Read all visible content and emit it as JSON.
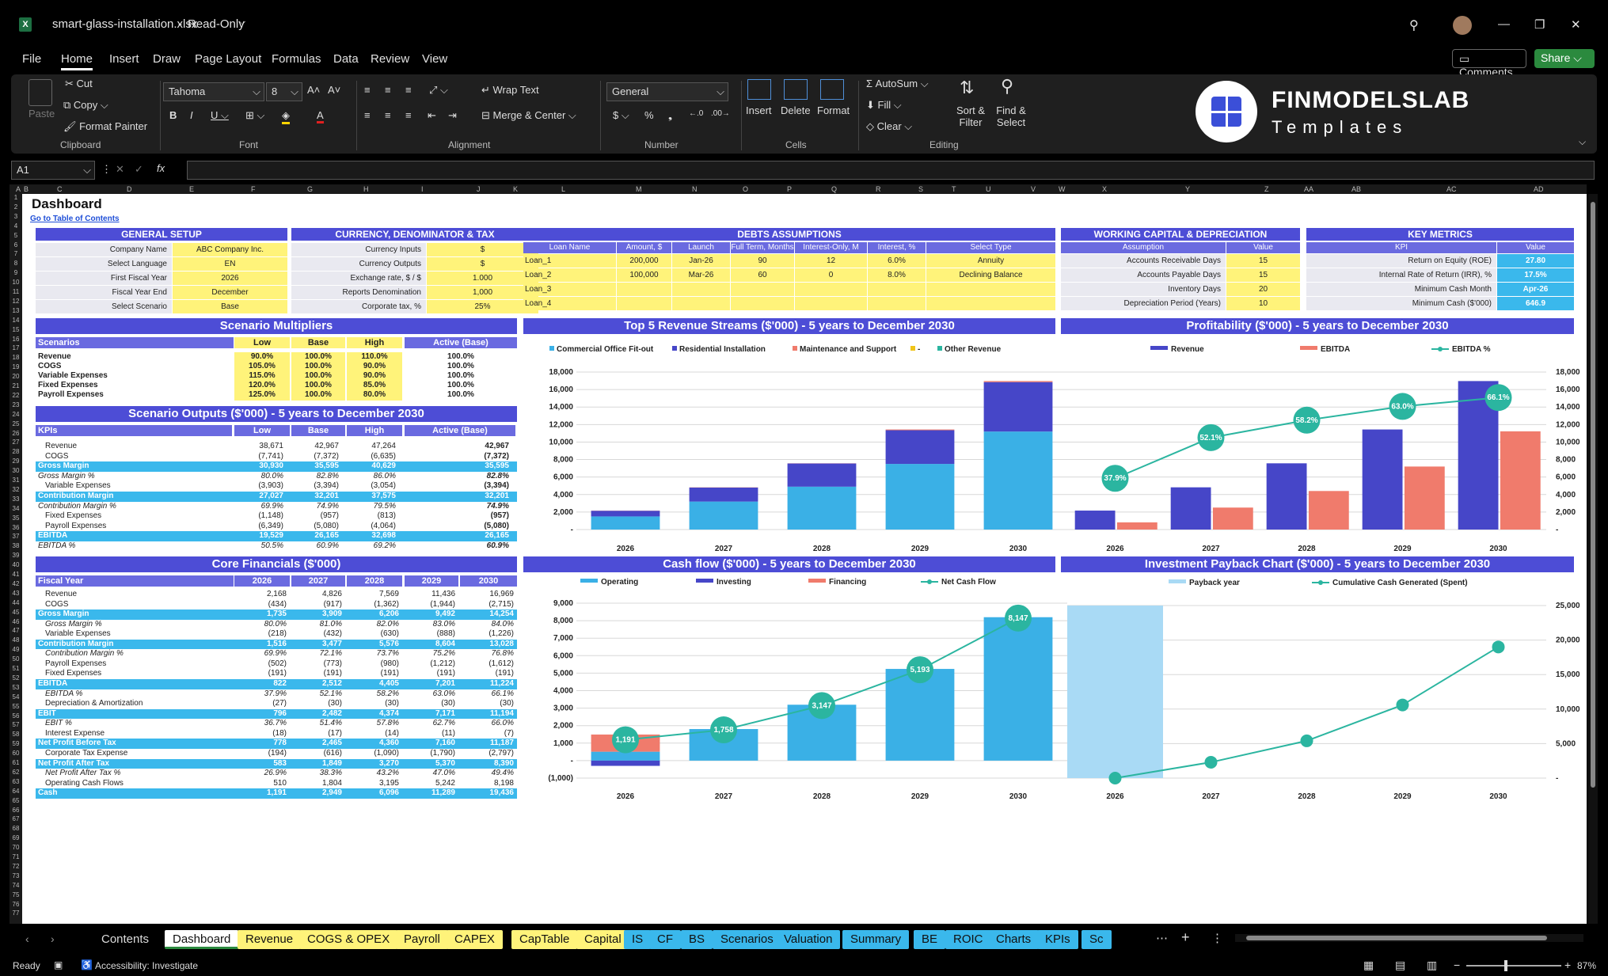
{
  "titlebar": {
    "filename": "smart-glass-installation.xlsx",
    "mode": "Read-Only"
  },
  "menu": [
    "File",
    "Home",
    "Insert",
    "Draw",
    "Page Layout",
    "Formulas",
    "Data",
    "Review",
    "View"
  ],
  "actions": {
    "comments": "Comments",
    "share": "Share"
  },
  "ribbon": {
    "clipboard": {
      "paste": "Paste",
      "cut": "Cut",
      "copy": "Copy",
      "format_painter": "Format Painter",
      "label": "Clipboard"
    },
    "font": {
      "name": "Tahoma",
      "size": "8",
      "label": "Font"
    },
    "alignment": {
      "wrap": "Wrap Text",
      "merge": "Merge & Center",
      "label": "Alignment"
    },
    "number": {
      "format": "General",
      "label": "Number"
    },
    "cells": {
      "insert": "Insert",
      "delete": "Delete",
      "format": "Format",
      "label": "Cells"
    },
    "editing": {
      "autosum": "AutoSum",
      "fill": "Fill",
      "clear": "Clear",
      "sort": "Sort & Filter",
      "find": "Find & Select",
      "label": "Editing"
    }
  },
  "logo": {
    "line1": "FINMODELSLAB",
    "line2": "Templates"
  },
  "formula": {
    "namebox": "A1",
    "fx": "fx"
  },
  "sheet": {
    "title": "Dashboard",
    "link": "Go to Table of Contents"
  },
  "general_setup": {
    "title": "GENERAL SETUP",
    "rows": [
      [
        "Company Name",
        "ABC Company Inc."
      ],
      [
        "Select Language",
        "EN"
      ],
      [
        "First Fiscal Year",
        "2026"
      ],
      [
        "Fiscal Year End",
        "December"
      ],
      [
        "Select Scenario",
        "Base"
      ]
    ]
  },
  "currency": {
    "title": "CURRENCY, DENOMINATOR & TAX",
    "rows": [
      [
        "Currency Inputs",
        "$"
      ],
      [
        "Currency Outputs",
        "$"
      ],
      [
        "Exchange rate, $ / $",
        "1.000"
      ],
      [
        "Reports Denomination",
        "1,000"
      ],
      [
        "Corporate tax, %",
        "25%"
      ]
    ]
  },
  "debts": {
    "title": "DEBTS ASSUMPTIONS",
    "headers": [
      "Loan Name",
      "Amount, $",
      "Launch",
      "Full Term, Months",
      "Interest-Only, M",
      "Interest, %",
      "Select Type"
    ],
    "rows": [
      [
        "Loan_1",
        "200,000",
        "Jan-26",
        "90",
        "12",
        "6.0%",
        "Annuity"
      ],
      [
        "Loan_2",
        "100,000",
        "Mar-26",
        "60",
        "0",
        "8.0%",
        "Declining Balance"
      ],
      [
        "Loan_3",
        "",
        "",
        "",
        "",
        "",
        ""
      ],
      [
        "Loan_4",
        "",
        "",
        "",
        "",
        "",
        ""
      ]
    ]
  },
  "working_capital": {
    "title": "WORKING CAPITAL & DEPRECIATION",
    "headers": [
      "Assumption",
      "Value"
    ],
    "rows": [
      [
        "Accounts Receivable Days",
        "15"
      ],
      [
        "Accounts Payable Days",
        "15"
      ],
      [
        "Inventory Days",
        "20"
      ],
      [
        "Depreciation Period (Years)",
        "10"
      ]
    ]
  },
  "key_metrics": {
    "title": "KEY METRICS",
    "headers": [
      "KPI",
      "Value"
    ],
    "rows": [
      [
        "Return on Equity (ROE)",
        "27.80"
      ],
      [
        "Internal Rate of Return (IRR), %",
        "17.5%"
      ],
      [
        "Minimum Cash Month",
        "Apr-26"
      ],
      [
        "Minimum Cash ($'000)",
        "646.9"
      ]
    ]
  },
  "multipliers": {
    "title": "Scenario Multipliers",
    "headers": [
      "Scenarios",
      "Low",
      "Base",
      "High",
      "Active (Base)"
    ],
    "rows": [
      [
        "Revenue",
        "90.0%",
        "100.0%",
        "110.0%",
        "100.0%"
      ],
      [
        "COGS",
        "105.0%",
        "100.0%",
        "90.0%",
        "100.0%"
      ],
      [
        "Variable Expenses",
        "115.0%",
        "100.0%",
        "90.0%",
        "100.0%"
      ],
      [
        "Fixed Expenses",
        "120.0%",
        "100.0%",
        "85.0%",
        "100.0%"
      ],
      [
        "Payroll Expenses",
        "125.0%",
        "100.0%",
        "80.0%",
        "100.0%"
      ]
    ]
  },
  "scenario_outputs": {
    "title": "Scenario Outputs ($'000) - 5 years to December 2030",
    "headers": [
      "KPIs",
      "Low",
      "Base",
      "High",
      "Active (Base)"
    ],
    "rows": [
      [
        "Revenue",
        "38,671",
        "42,967",
        "47,264",
        "42,967",
        ""
      ],
      [
        "COGS",
        "(7,741)",
        "(7,372)",
        "(6,635)",
        "(7,372)",
        ""
      ],
      [
        "Gross Margin",
        "30,930",
        "35,595",
        "40,629",
        "35,595",
        "hl"
      ],
      [
        "Gross Margin %",
        "80.0%",
        "82.8%",
        "86.0%",
        "82.8%",
        "it"
      ],
      [
        "Variable Expenses",
        "(3,903)",
        "(3,394)",
        "(3,054)",
        "(3,394)",
        ""
      ],
      [
        "Contribution Margin",
        "27,027",
        "32,201",
        "37,575",
        "32,201",
        "hl"
      ],
      [
        "Contribution Margin %",
        "69.9%",
        "74.9%",
        "79.5%",
        "74.9%",
        "it"
      ],
      [
        "Fixed Expenses",
        "(1,148)",
        "(957)",
        "(813)",
        "(957)",
        ""
      ],
      [
        "Payroll Expenses",
        "(6,349)",
        "(5,080)",
        "(4,064)",
        "(5,080)",
        ""
      ],
      [
        "EBITDA",
        "19,529",
        "26,165",
        "32,698",
        "26,165",
        "hl"
      ],
      [
        "EBITDA %",
        "50.5%",
        "60.9%",
        "69.2%",
        "60.9%",
        "it"
      ]
    ]
  },
  "core_financials": {
    "title": "Core Financials ($'000)",
    "headers": [
      "Fiscal Year",
      "2026",
      "2027",
      "2028",
      "2029",
      "2030"
    ],
    "rows": [
      [
        "Revenue",
        "2,168",
        "4,826",
        "7,569",
        "11,436",
        "16,969",
        ""
      ],
      [
        "COGS",
        "(434)",
        "(917)",
        "(1,362)",
        "(1,944)",
        "(2,715)",
        ""
      ],
      [
        "Gross Margin",
        "1,735",
        "3,909",
        "6,206",
        "9,492",
        "14,254",
        "hl"
      ],
      [
        "Gross Margin %",
        "80.0%",
        "81.0%",
        "82.0%",
        "83.0%",
        "84.0%",
        "it"
      ],
      [
        "Variable Expenses",
        "(218)",
        "(432)",
        "(630)",
        "(888)",
        "(1,226)",
        ""
      ],
      [
        "Contribution Margin",
        "1,516",
        "3,477",
        "5,576",
        "8,604",
        "13,028",
        "hl"
      ],
      [
        "Contribution Margin %",
        "69.9%",
        "72.1%",
        "73.7%",
        "75.2%",
        "76.8%",
        "it"
      ],
      [
        "Payroll Expenses",
        "(502)",
        "(773)",
        "(980)",
        "(1,212)",
        "(1,612)",
        ""
      ],
      [
        "Fixed Expenses",
        "(191)",
        "(191)",
        "(191)",
        "(191)",
        "(191)",
        ""
      ],
      [
        "EBITDA",
        "822",
        "2,512",
        "4,405",
        "7,201",
        "11,224",
        "hl"
      ],
      [
        "EBITDA %",
        "37.9%",
        "52.1%",
        "58.2%",
        "63.0%",
        "66.1%",
        "it"
      ],
      [
        "Depreciation & Amortization",
        "(27)",
        "(30)",
        "(30)",
        "(30)",
        "(30)",
        ""
      ],
      [
        "EBIT",
        "796",
        "2,482",
        "4,374",
        "7,171",
        "11,194",
        "hl"
      ],
      [
        "EBIT %",
        "36.7%",
        "51.4%",
        "57.8%",
        "62.7%",
        "66.0%",
        "it"
      ],
      [
        "Interest Expense",
        "(18)",
        "(17)",
        "(14)",
        "(11)",
        "(7)",
        ""
      ],
      [
        "Net Profit Before Tax",
        "778",
        "2,465",
        "4,360",
        "7,160",
        "11,187",
        "hl"
      ],
      [
        "Corporate Tax Expense",
        "(194)",
        "(616)",
        "(1,090)",
        "(1,790)",
        "(2,797)",
        ""
      ],
      [
        "Net Profit After Tax",
        "583",
        "1,849",
        "3,270",
        "5,370",
        "8,390",
        "hl"
      ],
      [
        "Net Profit After Tax %",
        "26.9%",
        "38.3%",
        "43.2%",
        "47.0%",
        "49.4%",
        "it"
      ],
      [
        "Operating Cash Flows",
        "510",
        "1,804",
        "3,195",
        "5,242",
        "8,198",
        ""
      ],
      [
        "Cash",
        "1,191",
        "2,949",
        "6,096",
        "11,289",
        "19,436",
        "hl"
      ]
    ]
  },
  "chart_titles": {
    "revenue": "Top 5 Revenue Streams ($'000) - 5 years to December 2030",
    "profit": "Profitability ($'000) - 5 years to December 2030",
    "cash": "Cash flow ($'000) - 5 years to December 2030",
    "payback": "Investment Payback Chart ($'000) - 5 years to December 2030"
  },
  "chart_data": [
    {
      "type": "bar",
      "stacked": true,
      "categories": [
        "2026",
        "2027",
        "2028",
        "2029",
        "2030"
      ],
      "series": [
        {
          "name": "Commercial Office Fit-out",
          "values": [
            1500,
            3200,
            4900,
            7500,
            11200
          ],
          "color": "#3ab0e6"
        },
        {
          "name": "Residential Installation",
          "values": [
            650,
            1600,
            2650,
            3850,
            5650
          ],
          "color": "#4646c8"
        },
        {
          "name": "Maintenance and Support",
          "values": [
            18,
            26,
            19,
            86,
            119
          ],
          "color": "#f07b6c"
        },
        {
          "name": "-",
          "values": [
            0,
            0,
            0,
            0,
            0
          ],
          "color": "#f0c419"
        },
        {
          "name": "Other Revenue",
          "values": [
            0,
            0,
            0,
            0,
            0
          ],
          "color": "#2bb5a0"
        }
      ],
      "ylim": [
        0,
        18000
      ],
      "yticks": [
        "-",
        "2,000",
        "4,000",
        "6,000",
        "8,000",
        "10,000",
        "12,000",
        "14,000",
        "16,000",
        "18,000"
      ]
    },
    {
      "type": "bar",
      "categories": [
        "2026",
        "2027",
        "2028",
        "2029",
        "2030"
      ],
      "series": [
        {
          "name": "Revenue",
          "values": [
            2168,
            4826,
            7569,
            11436,
            16969
          ],
          "color": "#4646c8"
        },
        {
          "name": "EBITDA",
          "values": [
            822,
            2512,
            4405,
            7201,
            11224
          ],
          "color": "#f07b6c"
        },
        {
          "name": "EBITDA %",
          "values": [
            37.9,
            52.1,
            58.2,
            63.0,
            66.1
          ],
          "labels": [
            "37.9%",
            "52.1%",
            "58.2%",
            "63.0%",
            "66.1%"
          ],
          "color": "#2bb5a0"
        }
      ],
      "ylim": [
        0,
        18000
      ],
      "yticks": [
        "-",
        "2,000",
        "4,000",
        "6,000",
        "8,000",
        "10,000",
        "12,000",
        "14,000",
        "16,000",
        "18,000"
      ]
    },
    {
      "type": "bar",
      "categories": [
        "2026",
        "2027",
        "2028",
        "2029",
        "2030"
      ],
      "series": [
        {
          "name": "Operating",
          "values": [
            510,
            1804,
            3195,
            5242,
            8198
          ],
          "color": "#3ab0e6"
        },
        {
          "name": "Investing",
          "values": [
            -300,
            0,
            0,
            0,
            0
          ],
          "color": "#4646c8"
        },
        {
          "name": "Financing",
          "values": [
            981,
            0,
            0,
            0,
            0
          ],
          "color": "#f07b6c"
        },
        {
          "name": "Net Cash Flow",
          "values": [
            1191,
            1758,
            3147,
            5193,
            8147
          ],
          "labels": [
            "1,191",
            "1,758",
            "3,147",
            "5,193",
            "8,147"
          ],
          "color": "#2bb5a0"
        }
      ],
      "ylim": [
        -1000,
        9000
      ],
      "yticks": [
        "(1,000)",
        "-",
        "1,000",
        "2,000",
        "3,000",
        "4,000",
        "5,000",
        "6,000",
        "7,000",
        "8,000",
        "9,000"
      ]
    },
    {
      "type": "line",
      "categories": [
        "2026",
        "2027",
        "2028",
        "2029",
        "2030"
      ],
      "series": [
        {
          "name": "Payback year",
          "values": [
            25000,
            0,
            0,
            0,
            0
          ],
          "color": "#a9daf5"
        },
        {
          "name": "Cumulative Cash Generated (Spent)",
          "values": [
            0,
            2300,
            5400,
            10600,
            19000
          ],
          "color": "#2bb5a0"
        }
      ],
      "ylim": [
        0,
        25000
      ],
      "yticks": [
        "-",
        "5,000",
        "10,000",
        "15,000",
        "20,000",
        "25,000"
      ]
    }
  ],
  "tabs": [
    {
      "label": "Contents",
      "s": "w"
    },
    {
      "label": "Dashboard",
      "s": "act"
    },
    {
      "label": "Revenue",
      "s": "y"
    },
    {
      "label": "COGS & OPEX",
      "s": "y"
    },
    {
      "label": "Payroll",
      "s": "y"
    },
    {
      "label": "CAPEX",
      "s": "y"
    },
    {
      "label": "CapTable",
      "s": "y"
    },
    {
      "label": "Capital",
      "s": "y"
    },
    {
      "label": "IS",
      "s": "b"
    },
    {
      "label": "CF",
      "s": "b"
    },
    {
      "label": "BS",
      "s": "b"
    },
    {
      "label": "Scenarios",
      "s": "b"
    },
    {
      "label": "Valuation",
      "s": "b"
    },
    {
      "label": "Summary",
      "s": "b"
    },
    {
      "label": "BE",
      "s": "b"
    },
    {
      "label": "ROIC",
      "s": "b"
    },
    {
      "label": "Charts",
      "s": "b"
    },
    {
      "label": "KPIs",
      "s": "b"
    },
    {
      "label": "Sc",
      "s": "b"
    }
  ],
  "status": {
    "ready": "Ready",
    "accessibility": "Accessibility: Investigate",
    "zoom": "87%"
  }
}
